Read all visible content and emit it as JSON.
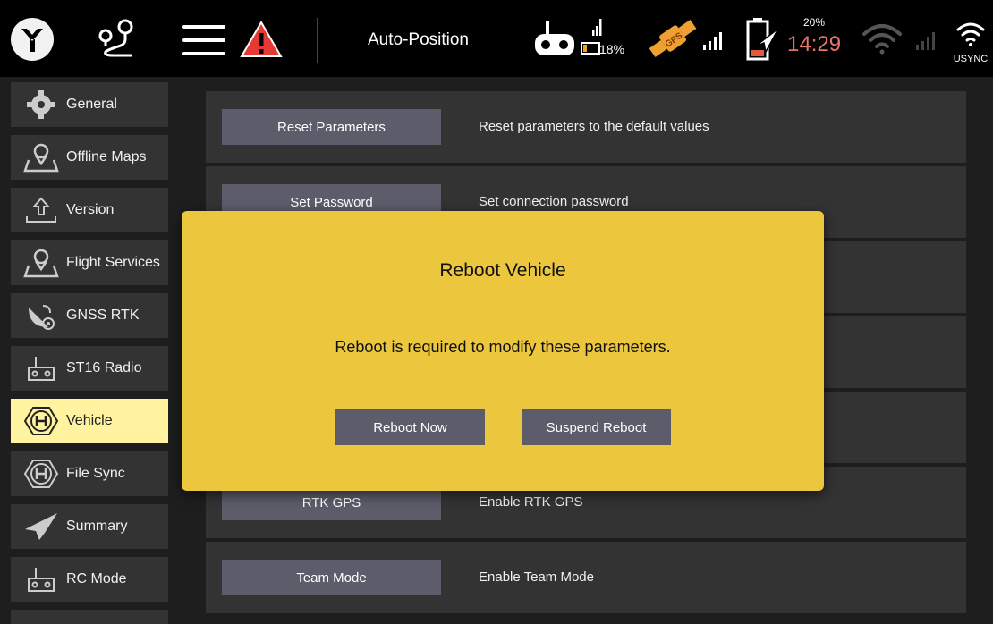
{
  "topbar": {
    "flight_mode": "Auto-Position",
    "rc_battery": "18%",
    "vehicle_battery": "20%",
    "clock": "14:29",
    "sync_label": "USYNC",
    "gps_badge": "GPS",
    "icons": [
      "app-logo-icon",
      "plan-route-icon",
      "menu-icon",
      "warning-icon",
      "rc-controller-icon",
      "rc-signal-icon",
      "rc-battery-icon",
      "gps-satellite-icon",
      "gps-signal-icon",
      "vehicle-battery-icon",
      "wifi-icon",
      "wifi-signal-icon",
      "usync-wifi-icon"
    ]
  },
  "sidebar": {
    "items": [
      {
        "label": "General",
        "icon": "gear-icon"
      },
      {
        "label": "Offline Maps",
        "icon": "map-pin-icon"
      },
      {
        "label": "Version",
        "icon": "upload-arrow-icon"
      },
      {
        "label": "Flight Services",
        "icon": "map-pin-icon"
      },
      {
        "label": "GNSS RTK",
        "icon": "satellite-dish-icon"
      },
      {
        "label": "ST16 Radio",
        "icon": "rc-controller-icon"
      },
      {
        "label": "Vehicle",
        "icon": "helipad-hexagon-icon",
        "active": true
      },
      {
        "label": "File Sync",
        "icon": "helipad-hexagon-icon"
      },
      {
        "label": "Summary",
        "icon": "paper-plane-icon"
      },
      {
        "label": "RC Mode",
        "icon": "rc-controller-icon"
      }
    ]
  },
  "main": {
    "rows": [
      {
        "button": "Reset Parameters",
        "desc": "Reset parameters to the default values"
      },
      {
        "button": "Set Password",
        "desc": "Set connection password"
      },
      {
        "button": "",
        "desc": ""
      },
      {
        "button": "",
        "desc": ""
      },
      {
        "button": "",
        "desc": ""
      },
      {
        "button": "RTK GPS",
        "desc": "Enable RTK GPS"
      },
      {
        "button": "Team Mode",
        "desc": "Enable Team Mode"
      }
    ]
  },
  "dialog": {
    "title": "Reboot Vehicle",
    "message": "Reboot is required to modify these parameters.",
    "primary": "Reboot Now",
    "secondary": "Suspend Reboot"
  },
  "colors": {
    "dialog_bg": "#ecc73d",
    "active_item_bg": "#fff3a0",
    "button_bg": "#5c5c6a",
    "clock": "#e8736a",
    "warning_red": "#e53935",
    "gps_orange": "#f0a030"
  }
}
